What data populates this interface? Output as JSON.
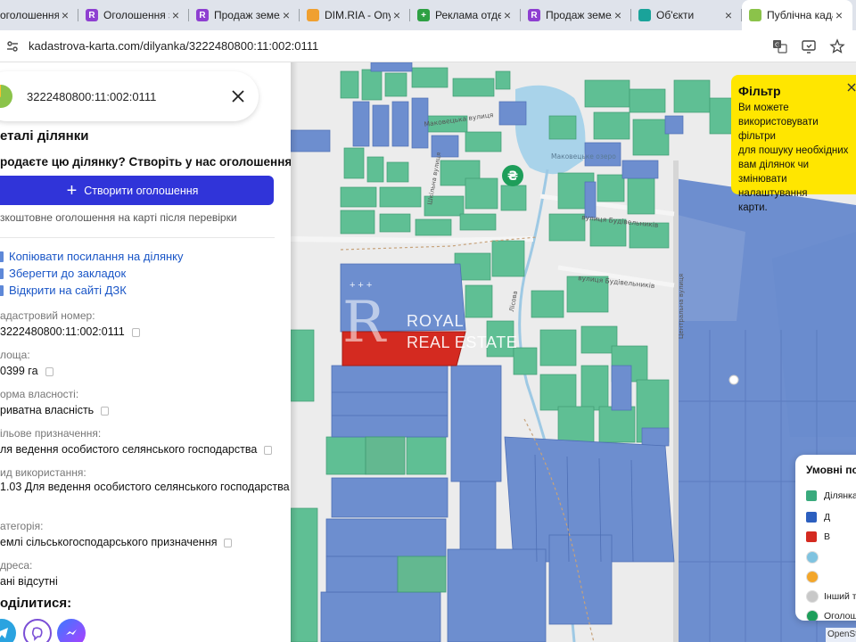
{
  "browser": {
    "tabs": [
      {
        "title": "оголошення С",
        "favicon_color": "#3c6df0",
        "favicon_glyph": ""
      },
      {
        "title": "Оголошення з",
        "favicon_color": "#8e3fd1",
        "favicon_glyph": "R"
      },
      {
        "title": "Продаж земел",
        "favicon_color": "#8e3fd1",
        "favicon_glyph": "R"
      },
      {
        "title": "DIM.RIA - Опуб",
        "favicon_color": "#f0a030",
        "favicon_glyph": ""
      },
      {
        "title": "Реклама отдел",
        "favicon_color": "#2ea043",
        "favicon_glyph": "+"
      },
      {
        "title": "Продаж земел",
        "favicon_color": "#8e3fd1",
        "favicon_glyph": "R"
      },
      {
        "title": "Об'єкти",
        "favicon_color": "#1aa39a",
        "favicon_glyph": ""
      },
      {
        "title": "Публічна када",
        "favicon_color": "#8bc34a",
        "favicon_glyph": ""
      }
    ],
    "active_tab": 7,
    "url": "kadastrova-karta.com/dilyanka/3222480800:11:002:0111"
  },
  "panel": {
    "search_value": "3222480800:11:002:0111",
    "details_heading": "еталі ділянки",
    "sell_prompt": "родаєте цю ділянку? Створіть у нас оголошення!",
    "create_button": "Створити оголошення",
    "note": "зкоштовне оголошення на карті після перевірки",
    "links": [
      "Копіювати посилання на ділянку",
      "Зберегти до закладок",
      "Відкрити на сайті ДЗК"
    ],
    "fields": [
      {
        "label": "адастровий номер:",
        "value": "3222480800:11:002:0111"
      },
      {
        "label": "лоща:",
        "value": "0399 га"
      },
      {
        "label": "орма власності:",
        "value": "риватна власність"
      },
      {
        "label": "ільове призначення:",
        "value": "ля ведення особистого селянського господарства"
      },
      {
        "label": "ид використання:",
        "value": "1.03 Для ведення особистого селянського господарства"
      },
      {
        "label": "атегорія:",
        "value": "емлі сільськогосподарського призначення"
      },
      {
        "label": "дреса:",
        "value": "ані відсутні"
      }
    ],
    "share_heading": "одiлитися:"
  },
  "map": {
    "street_labels": [
      "Маковецька вулиця",
      "вулиця Будівельників",
      "вулиця Будівельників",
      "Маковецьке озеро",
      "Центральна вулиця",
      "Шкільна вулиця",
      "Лісова"
    ],
    "watermark": {
      "stars": "+++",
      "letter": "R",
      "line1": "ROYAL",
      "line2": "REAL ESTATE"
    },
    "filter": {
      "title": "Фільтр",
      "body": "Ви можете\nвикористовувати фільтри\nдля пошуку необхідних\nвам ділянок чи\nзмінювати налаштування\nкарти."
    },
    "legend": {
      "title": "Умовні поз",
      "rows": [
        {
          "kind": "swatch",
          "color": "#3aaa7d",
          "label": "Ділянка с"
        },
        {
          "kind": "swatch",
          "color": "#2c5fbf",
          "label": "Д"
        },
        {
          "kind": "swatch",
          "color": "#d42a20",
          "label": "В"
        },
        {
          "kind": "icon",
          "color": "#7fc3e0",
          "label": ""
        },
        {
          "kind": "icon",
          "color": "#f3a62a",
          "label": ""
        },
        {
          "kind": "icon",
          "color": "#c8c8c8",
          "label": "Інший т"
        },
        {
          "kind": "icon",
          "color": "#1e9e5a",
          "label": "Оголош"
        }
      ]
    },
    "attribution": "OpenSt"
  },
  "colors": {
    "accent": "#3034d9",
    "link": "#1a56c7",
    "parcel_green": "#5fbf94",
    "parcel_blue": "#6f8fcf",
    "parcel_selected": "#d42a20",
    "filter_yellow": "#ffe600"
  }
}
